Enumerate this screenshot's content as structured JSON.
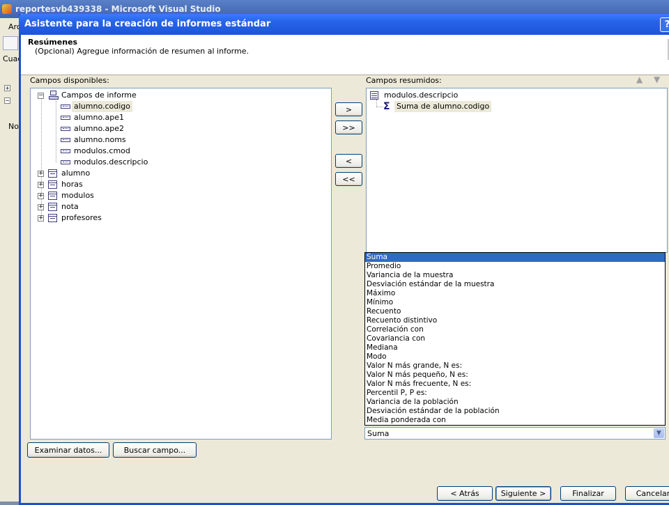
{
  "vs": {
    "title": "reportesvb439338 - Microsoft Visual Studio",
    "menu_partial": "Arc",
    "cuad_partial": "Cuad",
    "no_partial": "No"
  },
  "wizard": {
    "title": "Asistente para la creación de informes estándar",
    "help": "?",
    "header_title": "Resúmenes",
    "header_subtitle": "(Opcional) Agregue información de resumen al informe.",
    "available_label": "Campos disponibles:",
    "summarized_label": "Campos resumidos:",
    "available_tree": {
      "root": "Campos de informe",
      "fields": [
        "alumno.codigo",
        "alumno.ape1",
        "alumno.ape2",
        "alumno.noms",
        "modulos.cmod",
        "modulos.descripcio"
      ],
      "tables": [
        "alumno",
        "horas",
        "modulos",
        "nota",
        "profesores"
      ]
    },
    "summarized_tree": {
      "group": "modulos.descripcio",
      "summary": "Suma de alumno.codigo"
    },
    "move_buttons": {
      "add": ">",
      "add_all": ">>",
      "remove": "<",
      "remove_all": "<<"
    },
    "summary_options": [
      "Suma",
      "Promedio",
      "Variancia de la muestra",
      "Desviación estándar de la muestra",
      "Máximo",
      "Mínimo",
      "Recuento",
      "Recuento distintivo",
      "Correlación con",
      "Covariancia con",
      "Mediana",
      "Modo",
      "Valor N más grande, N es:",
      "Valor N más pequeño, N es:",
      "Valor N más frecuente, N es:",
      "Percentil P, P es:",
      "Variancia de la población",
      "Desviación estándar de la población",
      "Media ponderada con"
    ],
    "selected_summary": "Suma",
    "browse_button": "Examinar datos...",
    "find_button": "Buscar campo...",
    "back_button": "< Atrás",
    "next_button": "Siguiente >",
    "finish_button": "Finalizar",
    "cancel_button": "Cancelar"
  }
}
